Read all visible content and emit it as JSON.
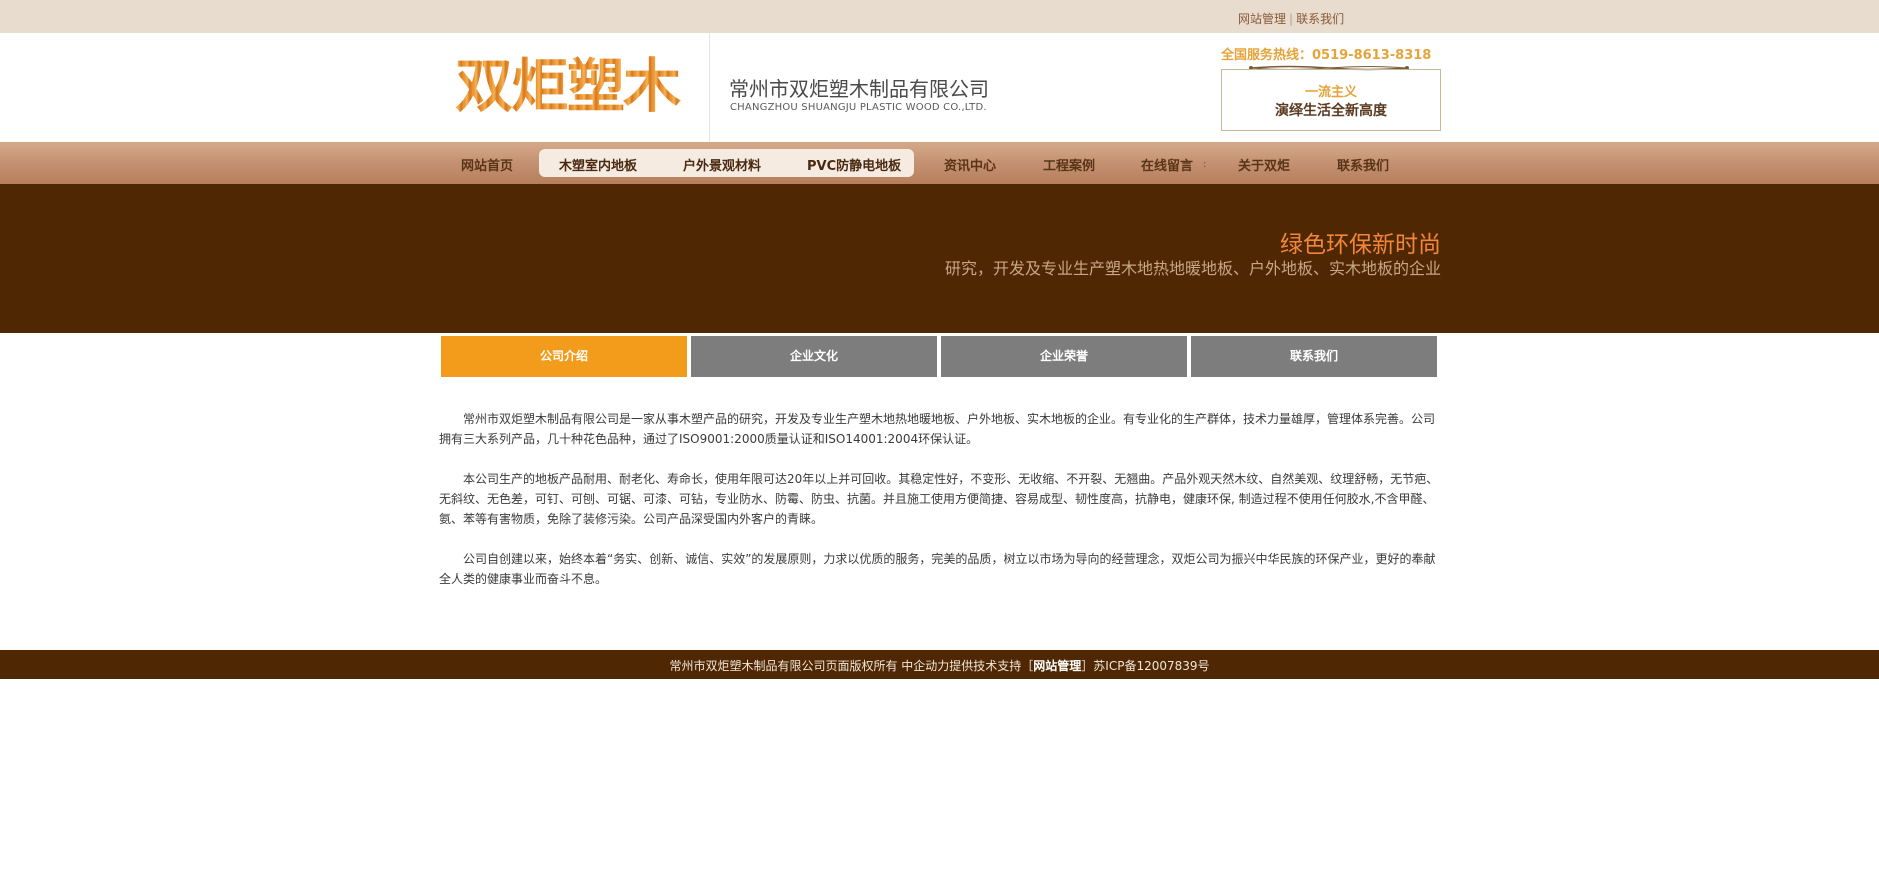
{
  "topbar": {
    "admin_link": "网站管理",
    "separator": "|",
    "contact_link": "联系我们"
  },
  "header": {
    "logo_text": "双炬塑木",
    "company_name_cn": "常州市双炬塑木制品有限公司",
    "company_name_en": "CHANGZHOU SHUANGJU PLASTIC WOOD CO.,LTD.",
    "hotline": "全国服务热线：0519-8613-8318",
    "slogan_line1": "一流主义",
    "slogan_line2": "演绎生活全新高度"
  },
  "nav": {
    "items": [
      {
        "label": "网站首页"
      },
      {
        "label": "木塑室内地板"
      },
      {
        "label": "户外景观材料"
      },
      {
        "label": "PVC防静电地板"
      },
      {
        "label": "资讯中心"
      },
      {
        "label": "工程案例"
      },
      {
        "label": "在线留言"
      },
      {
        "label": "关于双炬"
      },
      {
        "label": "联系我们"
      }
    ],
    "dot": ":"
  },
  "banner": {
    "title": "绿色环保新时尚",
    "subtitle": "研究，开发及专业生产塑木地热地暖地板、户外地板、实木地板的企业"
  },
  "tabs": [
    {
      "label": "公司介绍",
      "active": true
    },
    {
      "label": "企业文化",
      "active": false
    },
    {
      "label": "企业荣誉",
      "active": false
    },
    {
      "label": "联系我们",
      "active": false
    }
  ],
  "content": {
    "paragraphs": [
      "常州市双炬塑木制品有限公司是一家从事木塑产品的研究，开发及专业生产塑木地热地暖地板、户外地板、实木地板的企业。有专业化的生产群体，技术力量雄厚，管理体系完善。公司拥有三大系列产品，几十种花色品种，通过了ISO9001:2000质量认证和ISO14001:2004环保认证。",
      "本公司生产的地板产品耐用、耐老化、寿命长，使用年限可达20年以上并可回收。其稳定性好，不变形、无收缩、不开裂、无翘曲。产品外观天然木纹、自然美观、纹理舒畅，无节疤、无斜纹、无色差，可钉、可刨、可锯、可漆、可钻，专业防水、防霉、防虫、抗菌。并且施工使用方便简捷、容易成型、韧性度高，抗静电，健康环保, 制造过程不使用任何胶水,不含甲醛、氨、苯等有害物质，免除了装修污染。公司产品深受国内外客户的青睐。",
      "公司自创建以来，始终本着“务实、创新、诚信、实效”的发展原则，力求以优质的服务，完美的品质，树立以市场为导向的经营理念，双炬公司为振兴中华民族的环保产业，更好的奉献全人类的健康事业而奋斗不息。"
    ]
  },
  "footer": {
    "text_before": "常州市双炬塑木制品有限公司页面版权所有 中企动力提供技术支持［",
    "admin_link": "网站管理",
    "text_after": "］苏ICP备12007839号"
  },
  "colors": {
    "topbar_bg": "#e7dccd",
    "brand_orange": "#f39b1b",
    "brand_brown": "#4f2702",
    "tab_inactive": "#7d7d7d"
  }
}
